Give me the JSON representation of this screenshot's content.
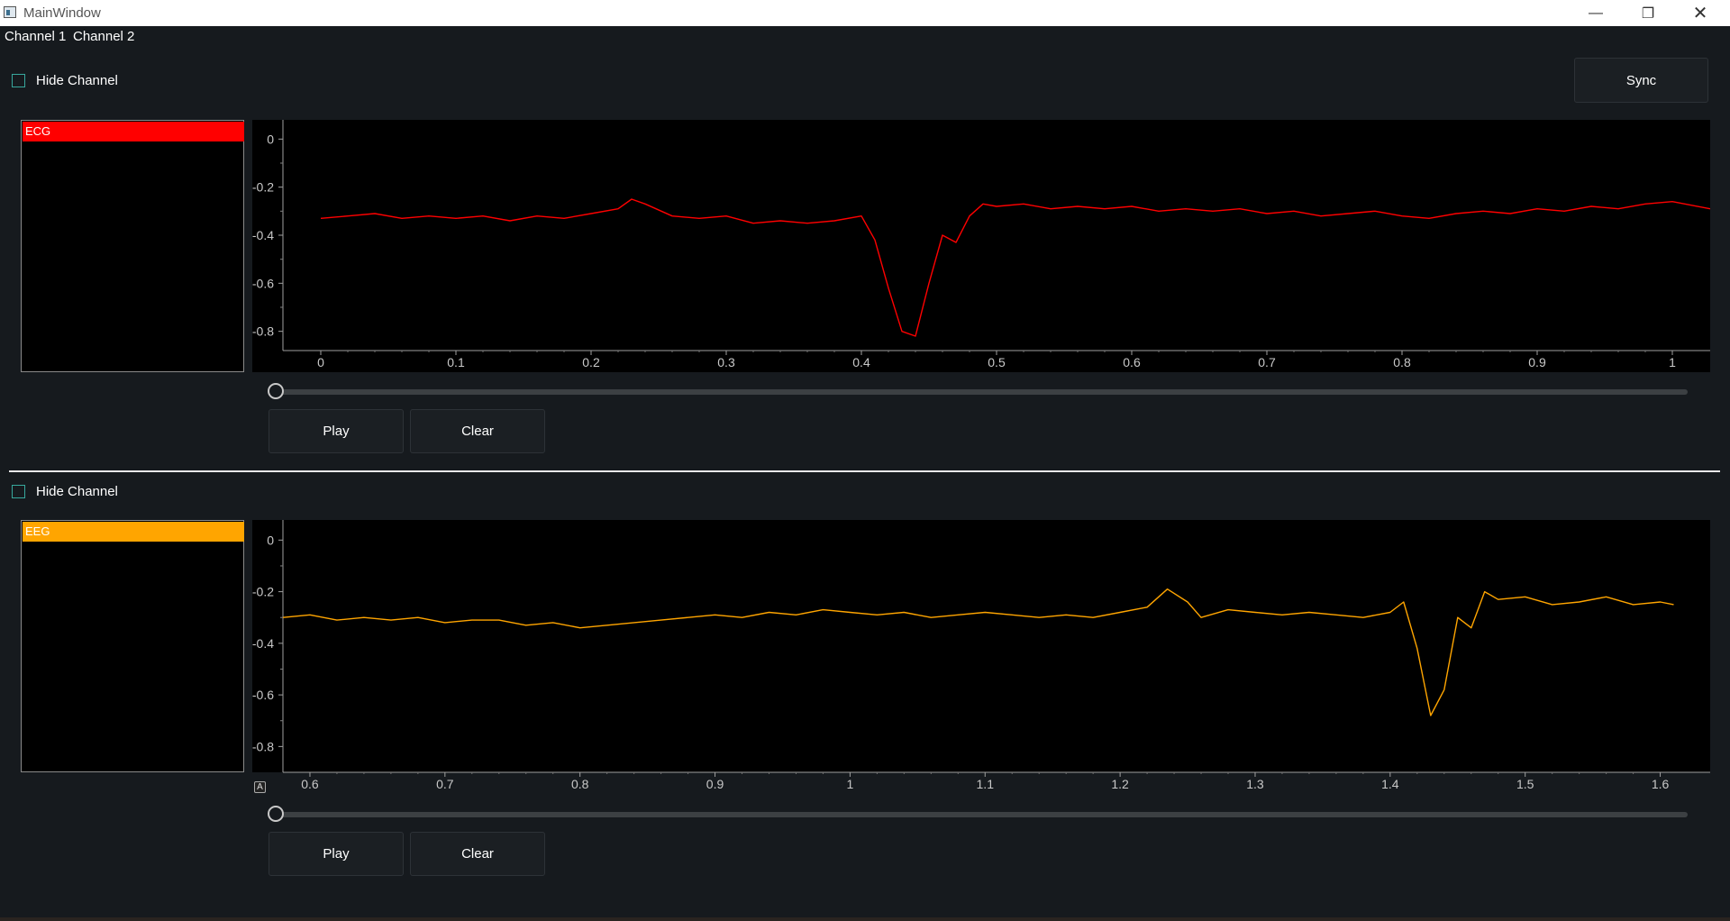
{
  "window": {
    "title": "MainWindow",
    "controls": [
      "minimize",
      "restore",
      "close"
    ]
  },
  "menu": {
    "items": [
      "Channel 1",
      "Channel 2"
    ]
  },
  "toolbar": {
    "sync_label": "Sync"
  },
  "channels": [
    {
      "hide_label": "Hide Channel",
      "hidden": false,
      "legend": {
        "label": "ECG",
        "color": "#ff0000"
      },
      "play_label": "Play",
      "clear_label": "Clear",
      "slider_value": 0
    },
    {
      "hide_label": "Hide Channel",
      "hidden": false,
      "legend": {
        "label": "EEG",
        "color": "#ffa500"
      },
      "play_label": "Play",
      "clear_label": "Clear",
      "slider_value": 0,
      "autorange_badge": "A"
    }
  ],
  "chart_data": [
    {
      "type": "line",
      "color": "#ff0000",
      "xlim": [
        -0.028,
        1.028
      ],
      "ylim": [
        -0.88,
        0.05
      ],
      "xticks": [
        0,
        0.1,
        0.2,
        0.3,
        0.4,
        0.5,
        0.6,
        0.7,
        0.8,
        0.9,
        1
      ],
      "xtick_labels": [
        "0",
        "0.1",
        "0.2",
        "0.3",
        "0.4",
        "0.5",
        "0.6",
        "0.7",
        "0.8",
        "0.9",
        "1"
      ],
      "yticks": [
        0,
        -0.2,
        -0.4,
        -0.6,
        -0.8
      ],
      "ytick_labels": [
        "0",
        "-0.2",
        "-0.4",
        "-0.6",
        "-0.8"
      ],
      "series": [
        {
          "x": [
            0,
            0.02,
            0.04,
            0.06,
            0.08,
            0.1,
            0.12,
            0.14,
            0.16,
            0.18,
            0.2,
            0.22,
            0.23,
            0.24,
            0.26,
            0.28,
            0.3,
            0.32,
            0.34,
            0.36,
            0.38,
            0.4,
            0.41,
            0.42,
            0.43,
            0.44,
            0.45,
            0.46,
            0.47,
            0.48,
            0.49,
            0.5,
            0.52,
            0.54,
            0.56,
            0.58,
            0.6,
            0.62,
            0.64,
            0.66,
            0.68,
            0.7,
            0.72,
            0.74,
            0.76,
            0.78,
            0.8,
            0.82,
            0.84,
            0.86,
            0.88,
            0.9,
            0.92,
            0.94,
            0.96,
            0.98,
            1.0,
            1.028
          ],
          "y": [
            -0.33,
            -0.32,
            -0.31,
            -0.33,
            -0.32,
            -0.33,
            -0.32,
            -0.34,
            -0.32,
            -0.33,
            -0.31,
            -0.29,
            -0.25,
            -0.27,
            -0.32,
            -0.33,
            -0.32,
            -0.35,
            -0.34,
            -0.35,
            -0.34,
            -0.32,
            -0.42,
            -0.62,
            -0.8,
            -0.82,
            -0.6,
            -0.4,
            -0.43,
            -0.32,
            -0.27,
            -0.28,
            -0.27,
            -0.29,
            -0.28,
            -0.29,
            -0.28,
            -0.3,
            -0.29,
            -0.3,
            -0.29,
            -0.31,
            -0.3,
            -0.32,
            -0.31,
            -0.3,
            -0.32,
            -0.33,
            -0.31,
            -0.3,
            -0.31,
            -0.29,
            -0.3,
            -0.28,
            -0.29,
            -0.27,
            -0.26,
            -0.29
          ]
        }
      ]
    },
    {
      "type": "line",
      "color": "#ffa500",
      "xlim": [
        0.58,
        1.637
      ],
      "ylim": [
        -0.9,
        0.05
      ],
      "xticks": [
        0.6,
        0.7,
        0.8,
        0.9,
        1,
        1.1,
        1.2,
        1.3,
        1.4,
        1.5,
        1.6
      ],
      "xtick_labels": [
        "0.6",
        "0.7",
        "0.8",
        "0.9",
        "1",
        "1.1",
        "1.2",
        "1.3",
        "1.4",
        "1.5",
        "1.6"
      ],
      "yticks": [
        0,
        -0.2,
        -0.4,
        -0.6,
        -0.8
      ],
      "ytick_labels": [
        "0",
        "-0.2",
        "-0.4",
        "-0.6",
        "-0.8"
      ],
      "series": [
        {
          "x": [
            0.58,
            0.6,
            0.62,
            0.64,
            0.66,
            0.68,
            0.7,
            0.72,
            0.74,
            0.76,
            0.78,
            0.8,
            0.82,
            0.84,
            0.86,
            0.88,
            0.9,
            0.92,
            0.94,
            0.96,
            0.98,
            1.0,
            1.02,
            1.04,
            1.06,
            1.08,
            1.1,
            1.12,
            1.14,
            1.16,
            1.18,
            1.2,
            1.22,
            1.235,
            1.25,
            1.26,
            1.28,
            1.3,
            1.32,
            1.34,
            1.36,
            1.38,
            1.4,
            1.41,
            1.42,
            1.43,
            1.44,
            1.45,
            1.46,
            1.47,
            1.48,
            1.5,
            1.52,
            1.54,
            1.56,
            1.58,
            1.6,
            1.61
          ],
          "y": [
            -0.3,
            -0.29,
            -0.31,
            -0.3,
            -0.31,
            -0.3,
            -0.32,
            -0.31,
            -0.31,
            -0.33,
            -0.32,
            -0.34,
            -0.33,
            -0.32,
            -0.31,
            -0.3,
            -0.29,
            -0.3,
            -0.28,
            -0.29,
            -0.27,
            -0.28,
            -0.29,
            -0.28,
            -0.3,
            -0.29,
            -0.28,
            -0.29,
            -0.3,
            -0.29,
            -0.3,
            -0.28,
            -0.26,
            -0.19,
            -0.24,
            -0.3,
            -0.27,
            -0.28,
            -0.29,
            -0.28,
            -0.29,
            -0.3,
            -0.28,
            -0.24,
            -0.42,
            -0.68,
            -0.58,
            -0.3,
            -0.34,
            -0.2,
            -0.23,
            -0.22,
            -0.25,
            -0.24,
            -0.22,
            -0.25,
            -0.24,
            -0.25
          ]
        }
      ]
    }
  ]
}
